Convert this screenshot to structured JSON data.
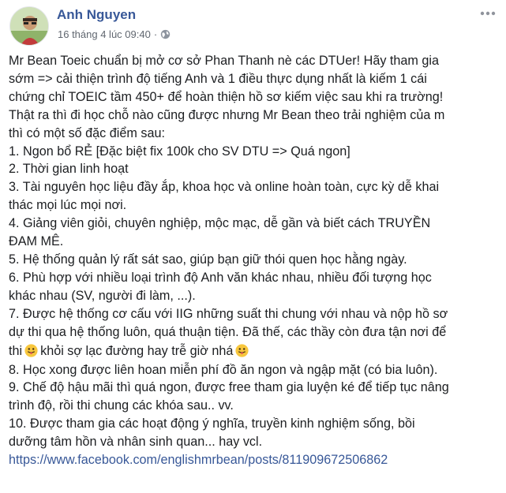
{
  "post": {
    "author": "Anh Nguyen",
    "timestamp": "16 tháng 4 lúc 09:40",
    "separator": "·",
    "privacy_icon": "globe-icon",
    "more_icon": "more-options-icon",
    "lines": [
      "Mr Bean Toeic chuẩn bị mở cơ sở Phan Thanh nè các DTUer! Hãy tham gia",
      "sớm => cải thiện trình độ tiếng Anh và 1 điều thực dụng nhất là kiếm 1 cái",
      "chứng chỉ TOEIC tầm 450+ để hoàn thiện hồ sơ kiếm việc sau khi ra trường!",
      "Thật ra thì đi học chỗ nào cũng được nhưng Mr Bean theo trải nghiệm của m",
      "thì có một số đặc điểm sau:",
      "1. Ngon bổ RẺ [Đặc biệt fix 100k cho SV DTU => Quá ngon]",
      "2. Thời gian linh hoạt",
      "3. Tài nguyên học liệu đầy ắp, khoa học và online hoàn toàn, cực kỳ dễ khai",
      "thác mọi lúc mọi nơi.",
      "4. Giảng viên giỏi, chuyên nghiệp, mộc mạc, dễ gần và biết cách TRUYỀN",
      "ĐAM MÊ.",
      "5. Hệ thống quản lý rất sát sao, giúp bạn giữ thói quen học hằng ngày.",
      "6. Phù hợp với nhiều loại trình độ Anh văn khác nhau, nhiều đối tượng học",
      "khác nhau (SV, người đi làm, ...).",
      "7. Được hệ thống cơ cấu với IIG những suất thi chung với nhau và nộp hồ sơ",
      "dự thi qua hệ thống luôn, quá thuận tiện. Đã thế, các thầy còn đưa tận nơi để",
      "8. Học xong được liên hoan miễn phí đồ ăn ngon và ngập mặt (có bia luôn).",
      "9. Chế độ hậu mãi thì quá ngon, được free tham gia luyện ké để tiếp tục nâng",
      "trình độ, rồi thi chung các khóa sau.. vv.",
      "10. Được tham gia các hoạt động ý nghĩa, truyền kinh nghiệm sống, bồi",
      "dưỡng tâm hồn và nhân sinh quan... hay vcl."
    ],
    "line_7c_before": "thi",
    "line_7c_middle": "khỏi sợ lạc đường hay trễ giờ nhá",
    "emoji_icon": "tongue-out-emoji-icon",
    "link": "https://www.facebook.com/englishmrbean/posts/811909672506862"
  }
}
